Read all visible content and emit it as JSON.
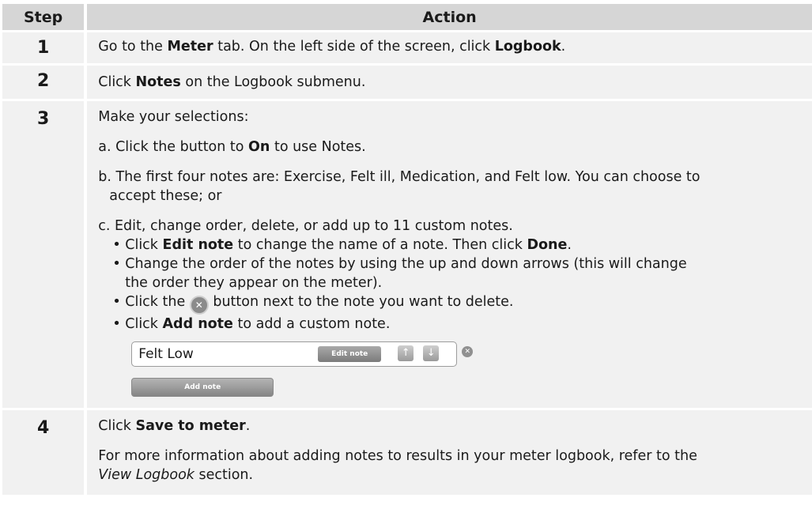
{
  "headers": {
    "step": "Step",
    "action": "Action"
  },
  "steps": [
    {
      "num": "1"
    },
    {
      "num": "2"
    },
    {
      "num": "3"
    },
    {
      "num": "4"
    }
  ],
  "s1": {
    "a": "Go to the ",
    "b": "Meter",
    "c": " tab. On the left side of the screen, click ",
    "d": "Logbook",
    "e": "."
  },
  "s2": {
    "a": "Click ",
    "b": "Notes",
    "c": " on the Logbook submenu."
  },
  "s3": {
    "intro": "Make your selections:",
    "a1": "a. Click the button to ",
    "a2": "On",
    "a3": " to use Notes.",
    "b1": "b. The first four notes are: Exercise, Felt ill, Medication, and Felt low. You can choose to",
    "b2": "accept these; or",
    "c1": "c. Edit, change order, delete, or add up to 11 custom notes.",
    "bul1a": "Click ",
    "bul1b": "Edit note",
    "bul1c": " to change the name of a note. Then click ",
    "bul1d": "Done",
    "bul1e": ".",
    "bul2a": "Change the order of the notes by using the up and down arrows (this will change",
    "bul2b": "the order they appear on the meter).",
    "bul3a": "Click the ",
    "bul3b": " button next to the note you want to delete.",
    "bul4a": "Click ",
    "bul4b": "Add note",
    "bul4c": " to add a custom note.",
    "demo": {
      "note_value": "Felt Low",
      "edit_label": "Edit note",
      "up_glyph": "↑",
      "down_glyph": "↓",
      "delete_glyph": "✕",
      "add_label": "Add note"
    }
  },
  "s4": {
    "a": "Click ",
    "b": "Save to meter",
    "c": ".",
    "d": "For more information about adding notes to results in your meter logbook, refer to the",
    "e": "View Logbook",
    "f": " section."
  }
}
